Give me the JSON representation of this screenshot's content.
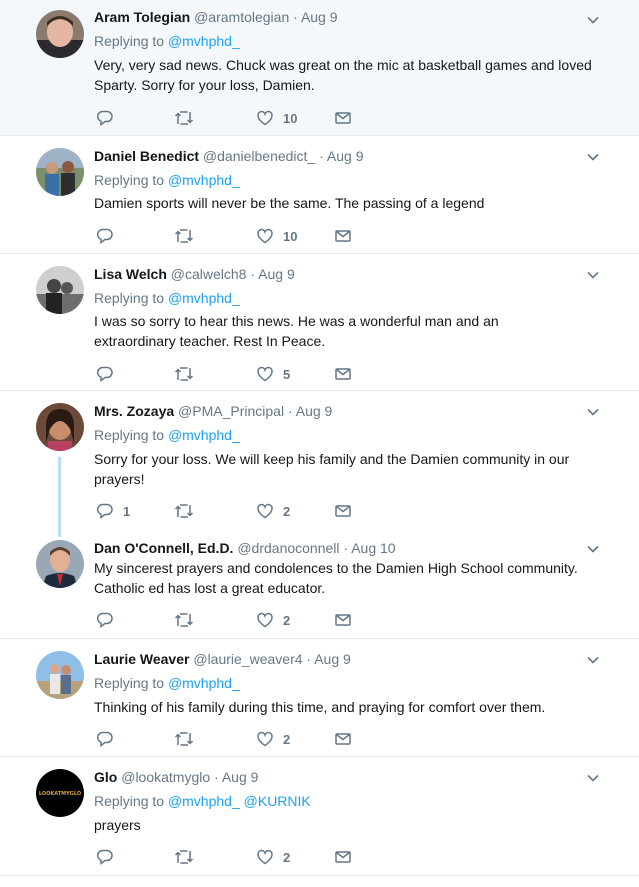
{
  "tweets": [
    {
      "name": "Aram Tolegian",
      "handle": "@aramtolegian",
      "date": "Aug 9",
      "replying_label": "Replying to",
      "replying_to": [
        "@mvhphd_"
      ],
      "text": "Very, very sad news. Chuck was great on the mic at basketball games and loved Sparty. Sorry for your loss, Damien.",
      "replies": "",
      "retweets": "",
      "likes": "10"
    },
    {
      "name": "Daniel Benedict",
      "handle": "@danielbenedict_",
      "date": "Aug 9",
      "replying_label": "Replying to",
      "replying_to": [
        "@mvhphd_"
      ],
      "text": "Damien sports will never be the same. The passing of a legend",
      "replies": "",
      "retweets": "",
      "likes": "10"
    },
    {
      "name": "Lisa Welch",
      "handle": "@calwelch8",
      "date": "Aug 9",
      "replying_label": "Replying to",
      "replying_to": [
        "@mvhphd_"
      ],
      "text": "I was so sorry to hear this news. He was a wonderful man and an extraordinary teacher. Rest In Peace.",
      "replies": "",
      "retweets": "",
      "likes": "5"
    },
    {
      "name": "Mrs. Zozaya",
      "handle": "@PMA_Principal",
      "date": "Aug 9",
      "replying_label": "Replying to",
      "replying_to": [
        "@mvhphd_"
      ],
      "text": "Sorry for your loss. We will keep his family and the  Damien community in our prayers!",
      "replies": "1",
      "retweets": "",
      "likes": "2"
    },
    {
      "name": "Dan O'Connell, Ed.D.",
      "handle": "@drdanoconnell",
      "date": "Aug 10",
      "replying_label": "",
      "replying_to": [],
      "text": "My sincerest prayers and condolences to the Damien High School community. Catholic ed has lost a great educator.",
      "replies": "",
      "retweets": "",
      "likes": "2"
    },
    {
      "name": "Laurie Weaver",
      "handle": "@laurie_weaver4",
      "date": "Aug 9",
      "replying_label": "Replying to",
      "replying_to": [
        "@mvhphd_"
      ],
      "text": "Thinking of his family during this time, and praying for comfort over them.",
      "replies": "",
      "retweets": "",
      "likes": "2"
    },
    {
      "name": "Glo",
      "handle": "@lookatmyglo",
      "date": "Aug 9",
      "replying_label": "Replying to",
      "replying_to": [
        "@mvhphd_",
        "@KURNIK"
      ],
      "text": "prayers",
      "replies": "",
      "retweets": "",
      "likes": "2"
    }
  ],
  "avatars": {
    "glo_text": "LOOKATMYGLO"
  },
  "separator_dot": "·",
  "colors": {
    "link": "#1da1f2",
    "muted": "#657786",
    "thread_line": "#b4dff7",
    "highlight_bg": "#f5f8fa"
  }
}
